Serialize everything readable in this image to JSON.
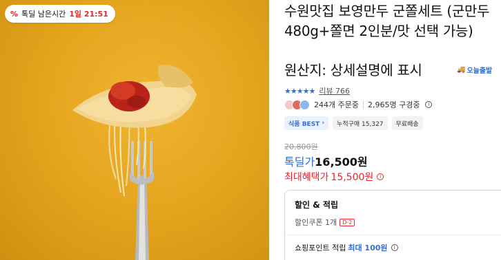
{
  "timer": {
    "label": "톡딜 남은시간",
    "value": "1일 21:51"
  },
  "product": {
    "title": "수원맛집 보영만두 군쫄세트 (군만두 480g+쫄면 2인분/맛 선택 가능)",
    "origin": "원산지: 상세설명에 표시",
    "delivery_badge": "오늘출발"
  },
  "rating": {
    "stars": "★★★★★",
    "review_label": "리뷰 766"
  },
  "social": {
    "ordering": "244개 주문중",
    "subscribers": "2,965명 구경중"
  },
  "tags": {
    "best": "식품 BEST",
    "cumulative": "누적구매 15,327",
    "shipping": "무료배송"
  },
  "price": {
    "original": "20,800원",
    "deal_label": "톡딜가",
    "deal_price": "16,500원",
    "max_label": "최대혜택가",
    "max_price": "15,500원"
  },
  "benefits": {
    "title": "할인 & 적립",
    "coupon": "할인쿠폰 1개",
    "coupon_badge": "D-2",
    "points_label": "쇼핑포인트 적립",
    "points_max": "최대 100원"
  },
  "colors": {
    "accent": "#2f6fd8",
    "sale": "#e8242e",
    "image_bg": "#e3a21c"
  }
}
